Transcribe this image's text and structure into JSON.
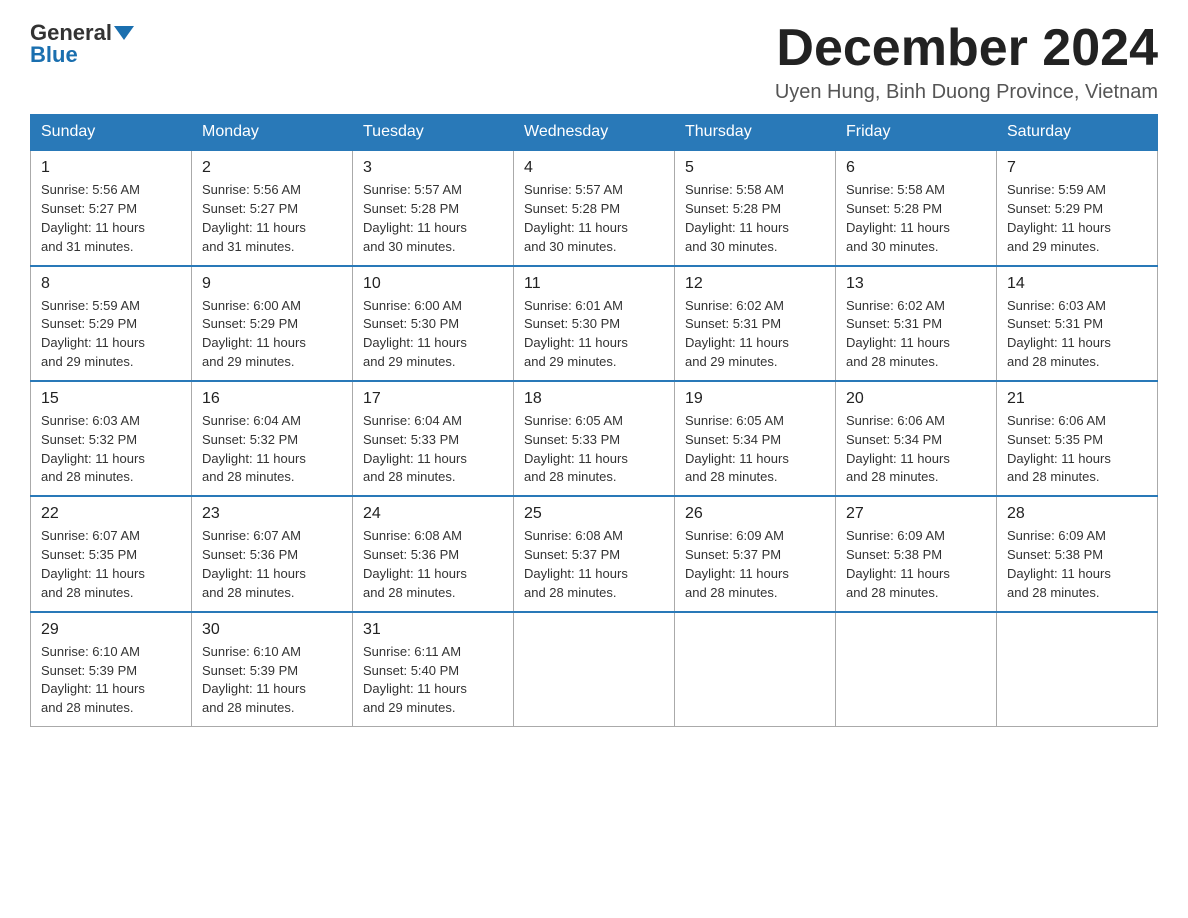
{
  "header": {
    "logo_general": "General",
    "logo_blue": "Blue",
    "month_title": "December 2024",
    "location": "Uyen Hung, Binh Duong Province, Vietnam"
  },
  "days_of_week": [
    "Sunday",
    "Monday",
    "Tuesday",
    "Wednesday",
    "Thursday",
    "Friday",
    "Saturday"
  ],
  "weeks": [
    [
      {
        "day": "1",
        "sunrise": "5:56 AM",
        "sunset": "5:27 PM",
        "daylight": "11 hours and 31 minutes."
      },
      {
        "day": "2",
        "sunrise": "5:56 AM",
        "sunset": "5:27 PM",
        "daylight": "11 hours and 31 minutes."
      },
      {
        "day": "3",
        "sunrise": "5:57 AM",
        "sunset": "5:28 PM",
        "daylight": "11 hours and 30 minutes."
      },
      {
        "day": "4",
        "sunrise": "5:57 AM",
        "sunset": "5:28 PM",
        "daylight": "11 hours and 30 minutes."
      },
      {
        "day": "5",
        "sunrise": "5:58 AM",
        "sunset": "5:28 PM",
        "daylight": "11 hours and 30 minutes."
      },
      {
        "day": "6",
        "sunrise": "5:58 AM",
        "sunset": "5:28 PM",
        "daylight": "11 hours and 30 minutes."
      },
      {
        "day": "7",
        "sunrise": "5:59 AM",
        "sunset": "5:29 PM",
        "daylight": "11 hours and 29 minutes."
      }
    ],
    [
      {
        "day": "8",
        "sunrise": "5:59 AM",
        "sunset": "5:29 PM",
        "daylight": "11 hours and 29 minutes."
      },
      {
        "day": "9",
        "sunrise": "6:00 AM",
        "sunset": "5:29 PM",
        "daylight": "11 hours and 29 minutes."
      },
      {
        "day": "10",
        "sunrise": "6:00 AM",
        "sunset": "5:30 PM",
        "daylight": "11 hours and 29 minutes."
      },
      {
        "day": "11",
        "sunrise": "6:01 AM",
        "sunset": "5:30 PM",
        "daylight": "11 hours and 29 minutes."
      },
      {
        "day": "12",
        "sunrise": "6:02 AM",
        "sunset": "5:31 PM",
        "daylight": "11 hours and 29 minutes."
      },
      {
        "day": "13",
        "sunrise": "6:02 AM",
        "sunset": "5:31 PM",
        "daylight": "11 hours and 28 minutes."
      },
      {
        "day": "14",
        "sunrise": "6:03 AM",
        "sunset": "5:31 PM",
        "daylight": "11 hours and 28 minutes."
      }
    ],
    [
      {
        "day": "15",
        "sunrise": "6:03 AM",
        "sunset": "5:32 PM",
        "daylight": "11 hours and 28 minutes."
      },
      {
        "day": "16",
        "sunrise": "6:04 AM",
        "sunset": "5:32 PM",
        "daylight": "11 hours and 28 minutes."
      },
      {
        "day": "17",
        "sunrise": "6:04 AM",
        "sunset": "5:33 PM",
        "daylight": "11 hours and 28 minutes."
      },
      {
        "day": "18",
        "sunrise": "6:05 AM",
        "sunset": "5:33 PM",
        "daylight": "11 hours and 28 minutes."
      },
      {
        "day": "19",
        "sunrise": "6:05 AM",
        "sunset": "5:34 PM",
        "daylight": "11 hours and 28 minutes."
      },
      {
        "day": "20",
        "sunrise": "6:06 AM",
        "sunset": "5:34 PM",
        "daylight": "11 hours and 28 minutes."
      },
      {
        "day": "21",
        "sunrise": "6:06 AM",
        "sunset": "5:35 PM",
        "daylight": "11 hours and 28 minutes."
      }
    ],
    [
      {
        "day": "22",
        "sunrise": "6:07 AM",
        "sunset": "5:35 PM",
        "daylight": "11 hours and 28 minutes."
      },
      {
        "day": "23",
        "sunrise": "6:07 AM",
        "sunset": "5:36 PM",
        "daylight": "11 hours and 28 minutes."
      },
      {
        "day": "24",
        "sunrise": "6:08 AM",
        "sunset": "5:36 PM",
        "daylight": "11 hours and 28 minutes."
      },
      {
        "day": "25",
        "sunrise": "6:08 AM",
        "sunset": "5:37 PM",
        "daylight": "11 hours and 28 minutes."
      },
      {
        "day": "26",
        "sunrise": "6:09 AM",
        "sunset": "5:37 PM",
        "daylight": "11 hours and 28 minutes."
      },
      {
        "day": "27",
        "sunrise": "6:09 AM",
        "sunset": "5:38 PM",
        "daylight": "11 hours and 28 minutes."
      },
      {
        "day": "28",
        "sunrise": "6:09 AM",
        "sunset": "5:38 PM",
        "daylight": "11 hours and 28 minutes."
      }
    ],
    [
      {
        "day": "29",
        "sunrise": "6:10 AM",
        "sunset": "5:39 PM",
        "daylight": "11 hours and 28 minutes."
      },
      {
        "day": "30",
        "sunrise": "6:10 AM",
        "sunset": "5:39 PM",
        "daylight": "11 hours and 28 minutes."
      },
      {
        "day": "31",
        "sunrise": "6:11 AM",
        "sunset": "5:40 PM",
        "daylight": "11 hours and 29 minutes."
      },
      null,
      null,
      null,
      null
    ]
  ]
}
